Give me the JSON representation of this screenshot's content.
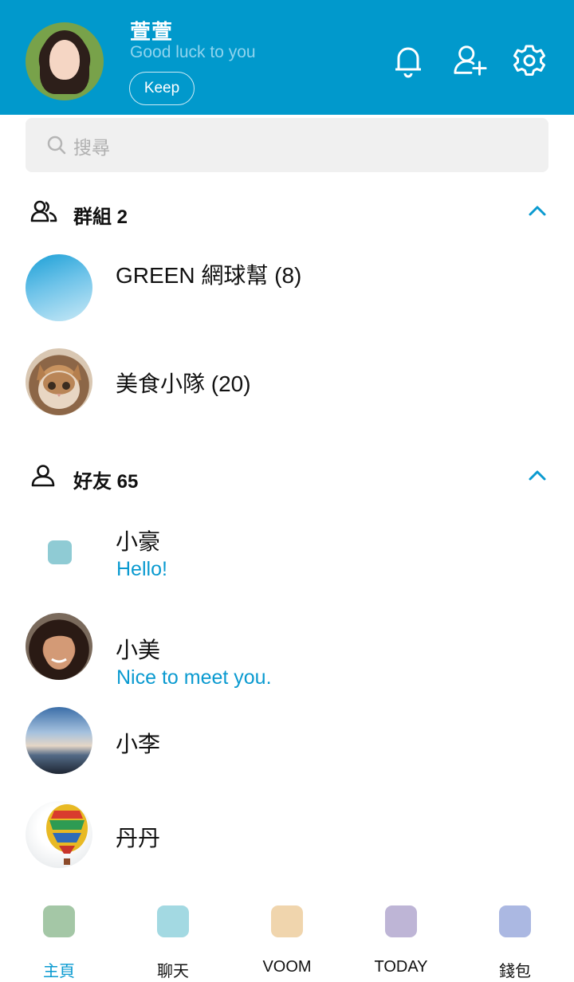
{
  "profile": {
    "name": "萱萱",
    "status": "Good luck to you",
    "keep_label": "Keep"
  },
  "header_icons": [
    "bell-icon",
    "add-friend-icon",
    "settings-gear-icon"
  ],
  "search": {
    "placeholder": "搜尋"
  },
  "groups": {
    "title": "群組 2",
    "items": [
      {
        "name": "GREEN 網球幫 (8)",
        "avatar": "blue-gradient-circle"
      },
      {
        "name": "美食小隊 (20)",
        "avatar": "cat-photo"
      }
    ]
  },
  "friends": {
    "title": "好友 65",
    "items": [
      {
        "name": "小豪",
        "status": "Hello!",
        "avatar": "placeholder-square"
      },
      {
        "name": "小美",
        "status": "Nice to meet you.",
        "avatar": "woman-photo"
      },
      {
        "name": "小李",
        "status": "",
        "avatar": "sky-photo"
      },
      {
        "name": "丹丹",
        "status": "",
        "avatar": "hot-air-balloon-photo"
      }
    ]
  },
  "bottom_nav": [
    {
      "label": "主頁",
      "color": "#a4c7a6",
      "active": true
    },
    {
      "label": "聊天",
      "color": "#a3d9e2",
      "active": false
    },
    {
      "label": "VOOM",
      "color": "#f0d5ad",
      "active": false
    },
    {
      "label": "TODAY",
      "color": "#beb5d6",
      "active": false
    },
    {
      "label": "錢包",
      "color": "#abb8e2",
      "active": false
    }
  ],
  "colors": {
    "header": "#0199cc",
    "accent": "#0a9ad0"
  }
}
